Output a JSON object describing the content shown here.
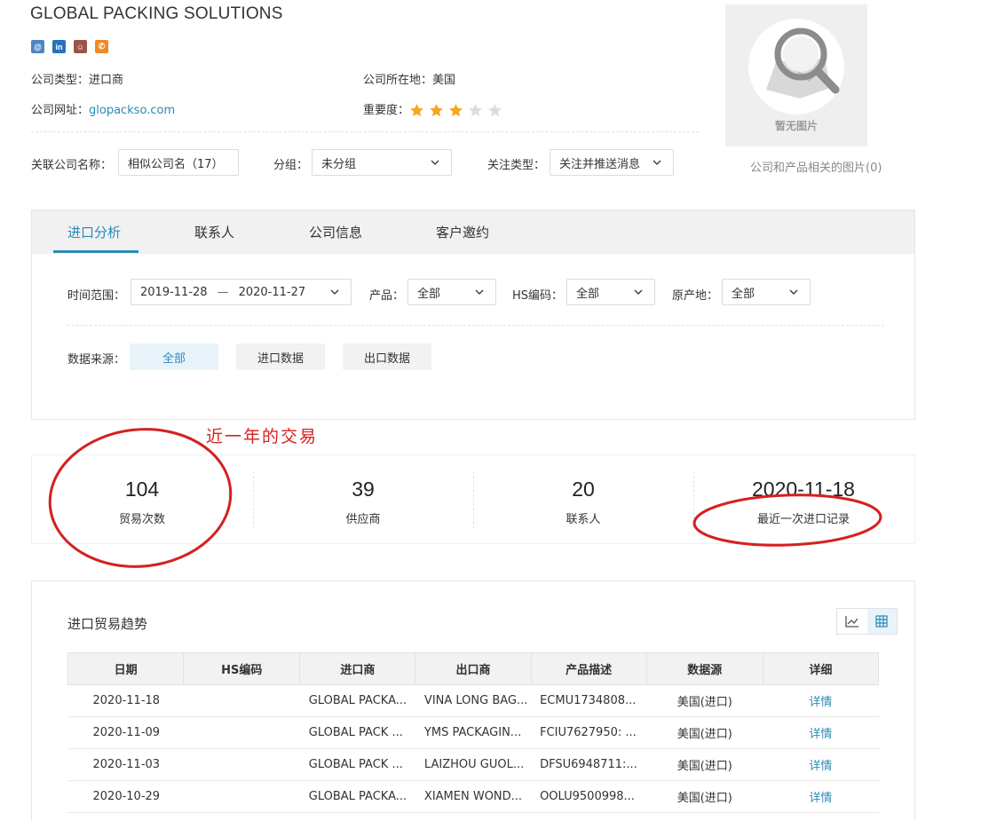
{
  "company": {
    "name": "GLOBAL PACKING SOLUTIONS",
    "type_label": "公司类型：",
    "type_value": "进口商",
    "location_label": "公司所在地：",
    "location_value": "美国",
    "website_label": "公司网址：",
    "website_value": "glopackso.com",
    "importance_label": "重要度：",
    "importance_stars": 3,
    "importance_max": 5
  },
  "social": {
    "icons": [
      {
        "name": "mail-icon",
        "glyph": "@",
        "color": "#4b86c5"
      },
      {
        "name": "linkedin-icon",
        "glyph": "in",
        "color": "#2673b8"
      },
      {
        "name": "contact-card-icon",
        "glyph": "☺",
        "color": "#9a5448"
      },
      {
        "name": "phone-icon",
        "glyph": "✆",
        "color": "#f08a24"
      }
    ]
  },
  "filters": {
    "related_label": "关联公司名称：",
    "related_value": "相似公司名（17）",
    "group_label": "分组：",
    "group_value": "未分组",
    "follow_label": "关注类型：",
    "follow_value": "关注并推送消息"
  },
  "photo": {
    "placeholder_text": "暂无图片",
    "caption": "公司和产品相关的图片(0)"
  },
  "tabs": [
    {
      "label": "进口分析",
      "active": true
    },
    {
      "label": "联系人",
      "active": false
    },
    {
      "label": "公司信息",
      "active": false
    },
    {
      "label": "客户邀约",
      "active": false
    }
  ],
  "analysis": {
    "time_label": "时间范围：",
    "date_from": "2019-11-28",
    "date_sep": "—",
    "date_to": "2020-11-27",
    "product_label": "产品：",
    "product_value": "全部",
    "hs_label": "HS编码：",
    "hs_value": "全部",
    "origin_label": "原产地：",
    "origin_value": "全部",
    "source_label": "数据来源：",
    "sources": [
      {
        "label": "全部",
        "active": true
      },
      {
        "label": "进口数据",
        "active": false
      },
      {
        "label": "出口数据",
        "active": false
      }
    ]
  },
  "annotation": {
    "note": "近一年的交易",
    "color": "#d52020"
  },
  "stats": [
    {
      "value": "104",
      "label": "贸易次数"
    },
    {
      "value": "39",
      "label": "供应商"
    },
    {
      "value": "20",
      "label": "联系人"
    },
    {
      "value": "2020-11-18",
      "label": "最近一次进口记录"
    }
  ],
  "trend": {
    "title": "进口贸易趋势",
    "columns": [
      "日期",
      "HS编码",
      "进口商",
      "出口商",
      "产品描述",
      "数据源",
      "详细"
    ],
    "rows": [
      {
        "date": "2020-11-18",
        "hs": "",
        "importer": "GLOBAL PACKA...",
        "exporter": "VINA LONG BAG...",
        "desc": "ECMU1734808...",
        "source": "美国(进口)",
        "detail": "详情"
      },
      {
        "date": "2020-11-09",
        "hs": "",
        "importer": "GLOBAL PACK ...",
        "exporter": "YMS PACKAGIN...",
        "desc": "FCIU7627950: ...",
        "source": "美国(进口)",
        "detail": "详情"
      },
      {
        "date": "2020-11-03",
        "hs": "",
        "importer": "GLOBAL PACK ...",
        "exporter": "LAIZHOU GUOL...",
        "desc": "DFSU6948711:...",
        "source": "美国(进口)",
        "detail": "详情"
      },
      {
        "date": "2020-10-29",
        "hs": "",
        "importer": "GLOBAL PACKA...",
        "exporter": "XIAMEN WOND...",
        "desc": "OOLU9500998...",
        "source": "美国(进口)",
        "detail": "详情"
      }
    ]
  },
  "colors": {
    "accent": "#2a8ab8",
    "star_on": "#f5a623",
    "star_off": "#dddddd"
  }
}
